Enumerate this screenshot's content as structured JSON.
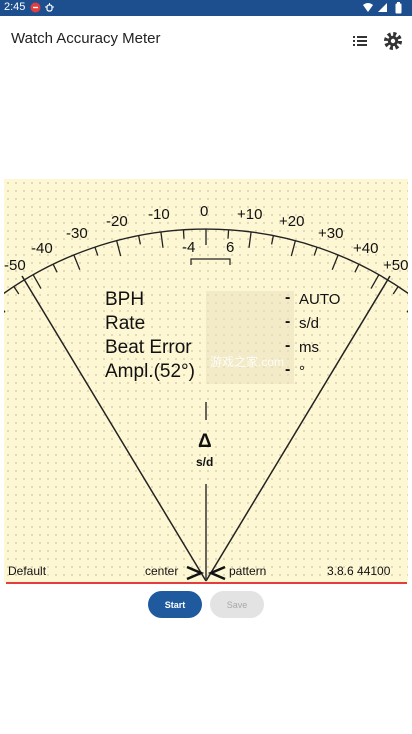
{
  "status_bar": {
    "time": "2:45",
    "icons": [
      "notification-badge-icon",
      "bug-icon",
      "wifi-icon",
      "signal-icon",
      "battery-icon"
    ]
  },
  "app_bar": {
    "title": "Watch Accuracy Meter",
    "actions": [
      "list-icon",
      "settings-gear-icon"
    ]
  },
  "meter": {
    "scale_labels": [
      "-50",
      "-40",
      "-30",
      "-20",
      "-10",
      "0",
      "+10",
      "+20",
      "+30",
      "+40",
      "+50"
    ],
    "inner_labels": [
      "-4",
      "6"
    ],
    "rows": [
      {
        "label": "BPH",
        "value": "-",
        "unit": "AUTO"
      },
      {
        "label": "Rate",
        "value": "-",
        "unit": "s/d"
      },
      {
        "label": "Beat Error",
        "value": "-",
        "unit": "ms"
      },
      {
        "label": "Ampl.(52°)",
        "value": "-",
        "unit": "°"
      }
    ],
    "delta_symbol": "Δ",
    "delta_unit": "s/d",
    "bottom": {
      "left": "Default",
      "center": "center",
      "pattern": "pattern",
      "right": "3.8.6 44100"
    }
  },
  "buttons": {
    "start": "Start",
    "save": "Save"
  },
  "watermark": "游戏之家.com",
  "colors": {
    "status_bar": "#1d4f8f",
    "meter_bg": "#fdf7d4",
    "accent_red": "#e33d3d",
    "primary_button": "#1f5a9e"
  }
}
